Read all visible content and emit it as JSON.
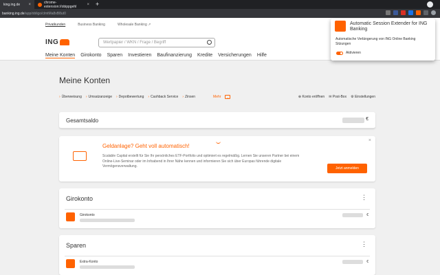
{
  "browser": {
    "tabs": [
      {
        "label": "king.ing.de",
        "active": false
      },
      {
        "label": "chrome-extension://obippgehl",
        "active": true
      }
    ],
    "new_tab": "+",
    "url_host": "banking.ing.de",
    "url_path": "/app/obligo/clmtMa8xB8ut0"
  },
  "header": {
    "segments": [
      "Privatkunden",
      "Business Banking",
      "Wholesale Banking ↗"
    ],
    "brand": "ING",
    "search_placeholder": "Wertpapier / WKN / Frage / Begriff",
    "nav": [
      "Meine Konten",
      "Girokonto",
      "Sparen",
      "Investieren",
      "Baufinanzierung",
      "Kredite",
      "Versicherungen",
      "Hilfe"
    ]
  },
  "main": {
    "title": "Meine Konten",
    "quick_links": [
      "Überweisung",
      "Umsatzanzeige",
      "Depotbewertung",
      "Cashback Service",
      "Zinsen"
    ],
    "more": "Mehr",
    "actions": [
      "Konto eröffnen",
      "Post-Box",
      "Einstellungen"
    ],
    "gesamtsaldo": "Gesamtsaldo",
    "currency": "€"
  },
  "promo": {
    "heading": "Geldanlage? Geht voll automatisch!",
    "text": "Scalable Capital erstellt für Sie Ihr persönliches ETF-Portfolio und optimiert es regelmäßig. Lernen Sie unseren Partner bei einem Online-Live-Seminar oder im Infoabend in Ihrer Nähe kennen und informieren Sie sich über Europas führende digitale Vermögensverwaltung.",
    "button": "Jetzt anmelden",
    "close": "×"
  },
  "sections": [
    {
      "heading": "Girokonto",
      "account": "Girokonto",
      "currency": "€"
    },
    {
      "heading": "Sparen",
      "account": "Extra-Konto",
      "currency": "€"
    }
  ],
  "popup": {
    "title": "Automatic Session Extender for ING Banking",
    "description": "Automatische Verlängerung von ING Online Banking Sitzungen",
    "toggle_label": "Aktivieren"
  },
  "colors": {
    "accent": "#ff6200"
  }
}
